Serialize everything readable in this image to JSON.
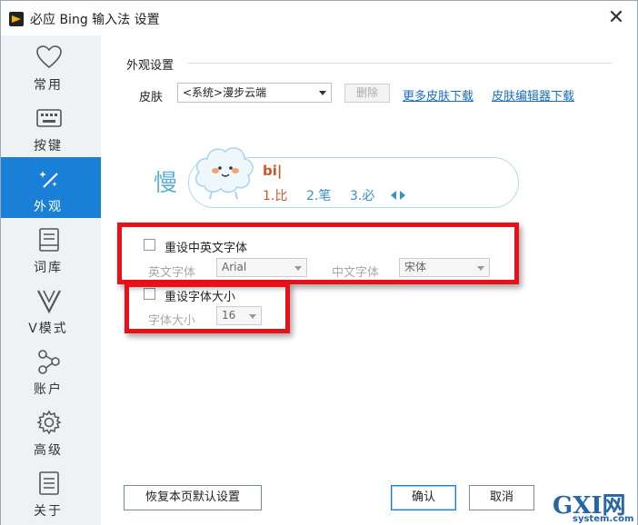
{
  "window": {
    "title": "必应 Bing 输入法 设置",
    "close_label": "✕"
  },
  "sidebar": {
    "items": [
      {
        "label": "常用",
        "icon": "heart-icon"
      },
      {
        "label": "按键",
        "icon": "keyboard-icon"
      },
      {
        "label": "外观",
        "icon": "magic-wand-icon",
        "active": true
      },
      {
        "label": "词库",
        "icon": "book-icon"
      },
      {
        "label": "V模式",
        "icon": "v-mode-icon"
      },
      {
        "label": "账户",
        "icon": "share-nodes-icon"
      },
      {
        "label": "高级",
        "icon": "gear-icon"
      },
      {
        "label": "关于",
        "icon": "document-icon"
      }
    ]
  },
  "appearance": {
    "section_title": "外观设置",
    "skin_label": "皮肤",
    "skin_value": "<系统>漫步云端",
    "delete_label": "删除",
    "more_skins_link": "更多皮肤下载",
    "skin_editor_link": "皮肤编辑器下载"
  },
  "preview": {
    "big_char": "慢",
    "typed": "bi|",
    "candidates": [
      "1.比",
      "2.笔",
      "3.必"
    ]
  },
  "font_reset": {
    "checkbox_label": "重设中英文字体",
    "en_font_label": "英文字体",
    "en_font_value": "Arial",
    "cn_font_label": "中文字体",
    "cn_font_value": "宋体"
  },
  "size_reset": {
    "checkbox_label": "重设字体大小",
    "size_label": "字体大小",
    "size_value": "16"
  },
  "footer": {
    "restore_label": "恢复本页默认设置",
    "ok_label": "确认",
    "cancel_label": "取消"
  },
  "watermark": {
    "text": "GXI网",
    "sub": "system.com"
  },
  "colors": {
    "accent": "#1a7fd6",
    "highlight": "#e8101a",
    "link": "#1a6bc0"
  }
}
